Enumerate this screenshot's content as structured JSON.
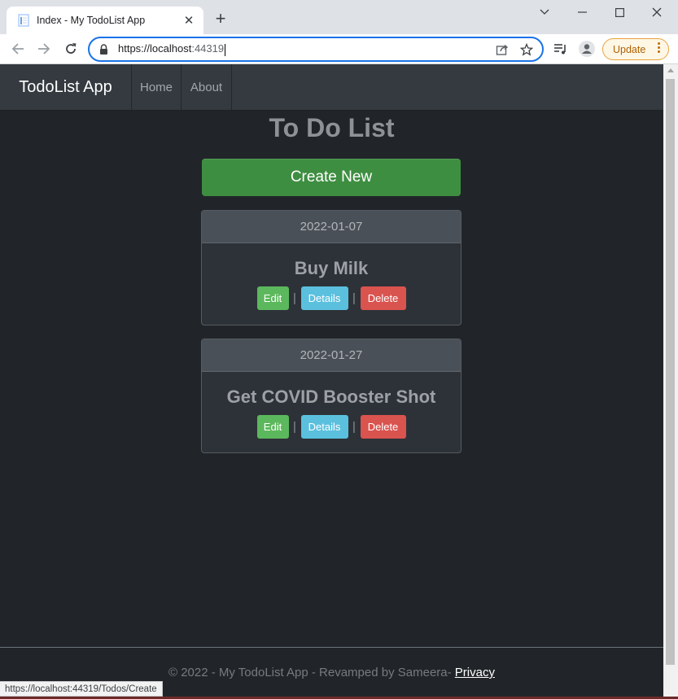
{
  "browser": {
    "tab_title": "Index - My TodoList App",
    "tab_close": "✕",
    "new_tab": "+",
    "url_host": "https://localhost",
    "url_port": ":44319",
    "update_label": "Update",
    "status_url": "https://localhost:44319/Todos/Create"
  },
  "navbar": {
    "brand": "TodoList App",
    "links": [
      {
        "label": "Home"
      },
      {
        "label": "About"
      }
    ]
  },
  "main": {
    "heading": "To Do List",
    "create_label": "Create New",
    "separator": "|",
    "todos": [
      {
        "date": "2022-01-07",
        "title": "Buy Milk",
        "edit": "Edit",
        "details": "Details",
        "delete": "Delete"
      },
      {
        "date": "2022-01-27",
        "title": "Get COVID Booster Shot",
        "edit": "Edit",
        "details": "Details",
        "delete": "Delete"
      }
    ]
  },
  "footer": {
    "text": "© 2022 - My TodoList App - Revamped by Sameera- ",
    "privacy": "Privacy"
  },
  "colors": {
    "page_bg": "#212529",
    "navbar_bg": "#343a40",
    "create_button": "#3e8e41",
    "edit_button": "#5cb85c",
    "details_button": "#5bc0de",
    "delete_button": "#d9534f",
    "omnibox_focus": "#1a73e8"
  },
  "icons": {
    "back": "arrow-left-icon",
    "forward": "arrow-right-icon",
    "reload": "reload-icon",
    "lock": "lock-icon",
    "share": "share-icon",
    "bookmark": "star-icon",
    "media": "media-control-icon",
    "profile": "profile-icon",
    "menu": "kebab-menu-icon"
  }
}
